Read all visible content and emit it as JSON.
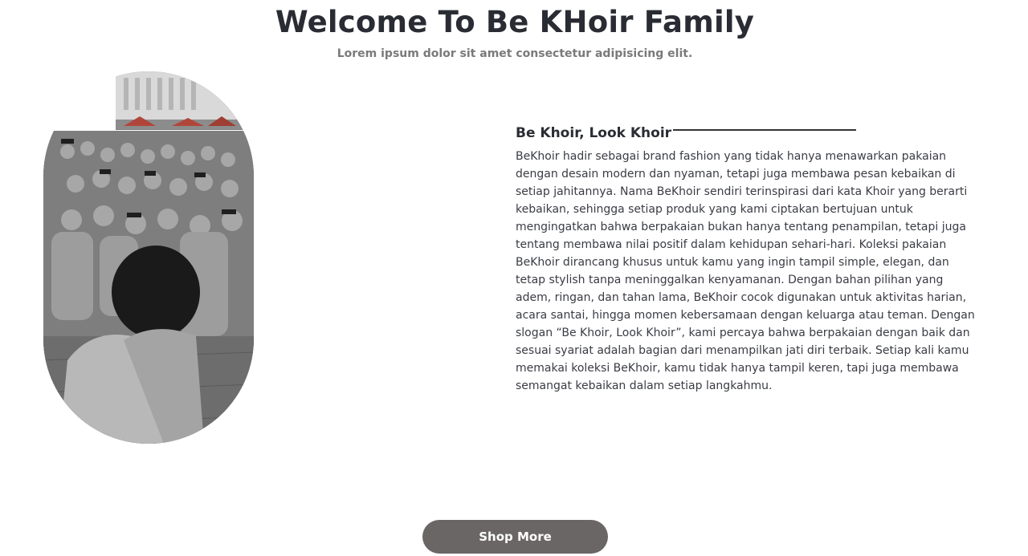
{
  "hero": {
    "title": "Welcome To Be KHoir Family",
    "subtitle": "Lorem ipsum dolor sit amet consectetur adipisicing elit."
  },
  "about": {
    "heading": "Be Khoir, Look Khoir",
    "body": "BeKhoir hadir sebagai brand fashion yang tidak hanya menawarkan pakaian dengan desain modern dan nyaman, tetapi juga membawa pesan kebaikan di setiap jahitannya. Nama BeKhoir sendiri terinspirasi dari kata Khoir yang berarti kebaikan, sehingga setiap produk yang kami ciptakan bertujuan untuk mengingatkan bahwa berpakaian bukan hanya tentang penampilan, tetapi juga tentang membawa nilai positif dalam kehidupan sehari-hari. Koleksi pakaian BeKhoir dirancang khusus untuk kamu yang ingin tampil simple, elegan, dan tetap stylish tanpa meninggalkan kenyamanan. Dengan bahan pilihan yang adem, ringan, dan tahan lama, BeKhoir cocok digunakan untuk aktivitas harian, acara santai, hingga momen kebersamaan dengan keluarga atau teman. Dengan slogan “Be Khoir, Look Khoir”, kami percaya bahwa berpakaian dengan baik dan sesuai syariat adalah bagian dari menampilkan jati diri terbaik. Setiap kali kamu memakai koleksi BeKhoir, kamu tidak hanya tampil keren, tapi juga membawa semangat kebaikan dalam setiap langkahmu."
  },
  "cta": {
    "shop_label": "Shop More"
  },
  "colors": {
    "button_bg": "#6b6666",
    "title_text": "#2a2c34",
    "subtitle_text": "#7a7a7a"
  }
}
